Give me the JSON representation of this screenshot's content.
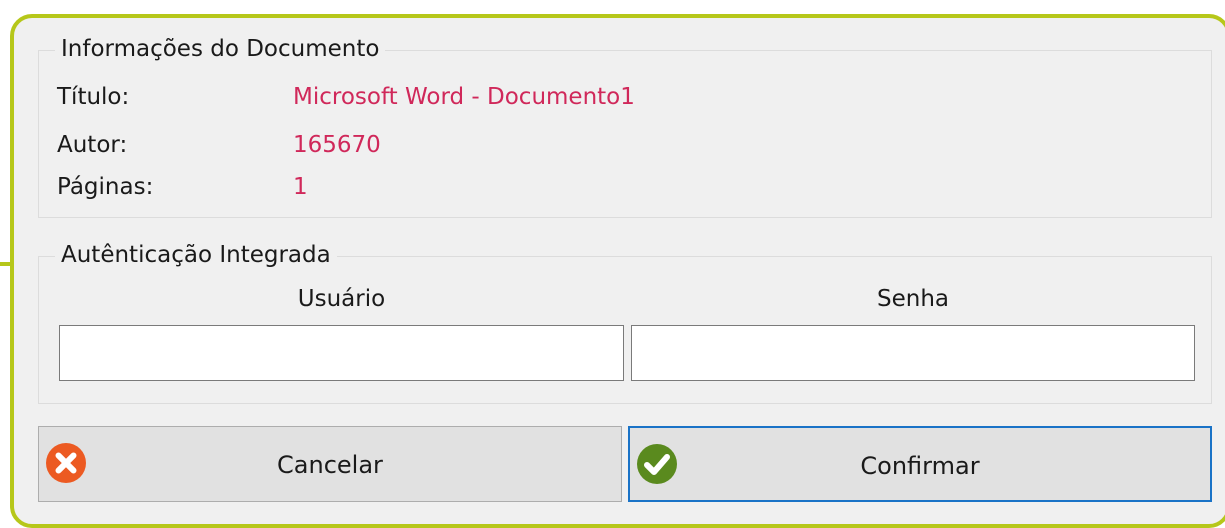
{
  "document_info": {
    "legend": "Informações do Documento",
    "rows": [
      {
        "label": "Título:",
        "value": "Microsoft Word - Documento1"
      },
      {
        "label": "Autor:",
        "value": "165670"
      },
      {
        "label": "Páginas:",
        "value": "1"
      }
    ]
  },
  "authentication": {
    "legend": "Autênticação Integrada",
    "user_header": "Usuário",
    "password_header": "Senha",
    "user_value": "",
    "password_value": ""
  },
  "buttons": {
    "cancel_label": "Cancelar",
    "confirm_label": "Confirmar",
    "cancel_icon": "close-circle-icon",
    "confirm_icon": "check-circle-icon"
  },
  "colors": {
    "frame_border": "#b6c71a",
    "value_text": "#d0285a",
    "cancel_icon": "#ec5a22",
    "confirm_icon": "#5a8a1e",
    "primary_button_border": "#1a73c7"
  }
}
